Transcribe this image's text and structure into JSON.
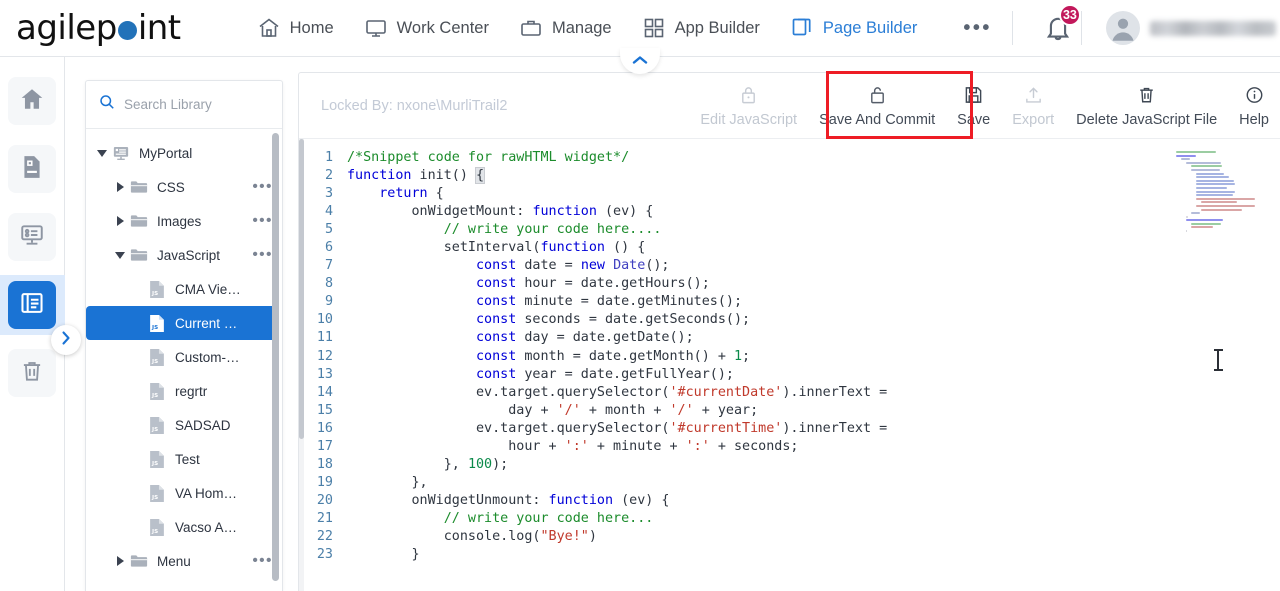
{
  "brand": {
    "name_part1": "agilep",
    "name_part2": "int"
  },
  "topnav": {
    "items": [
      {
        "label": "Home",
        "icon": "home-icon",
        "active": false
      },
      {
        "label": "Work Center",
        "icon": "monitor-icon",
        "active": false
      },
      {
        "label": "Manage",
        "icon": "briefcase-icon",
        "active": false
      },
      {
        "label": "App Builder",
        "icon": "grid-icon",
        "active": false
      },
      {
        "label": "Page Builder",
        "icon": "pages-icon",
        "active": true
      }
    ],
    "more_label": "•••",
    "notification_count": "33",
    "username": "",
    "collapse_label": "collapse-navigation"
  },
  "rail": {
    "items": [
      {
        "name": "home",
        "icon": "home-icon",
        "active": false
      },
      {
        "name": "pages",
        "icon": "page-icon",
        "active": false
      },
      {
        "name": "forms",
        "icon": "form-layout-icon",
        "active": false
      },
      {
        "name": "library",
        "icon": "library-icon",
        "active": true
      },
      {
        "name": "recycle-bin",
        "icon": "trash-icon",
        "active": false
      }
    ],
    "expand_label": "expand-rail"
  },
  "library": {
    "search_placeholder": "Search Library",
    "search_value": "",
    "tree": [
      {
        "label": "MyPortal",
        "icon": "portal-icon",
        "indent": 0,
        "toggle": "down",
        "dots": false,
        "selected": false
      },
      {
        "label": "CSS",
        "icon": "folder-icon",
        "indent": 1,
        "toggle": "right",
        "dots": true,
        "selected": false
      },
      {
        "label": "Images",
        "icon": "folder-icon",
        "indent": 1,
        "toggle": "right",
        "dots": true,
        "selected": false
      },
      {
        "label": "JavaScript",
        "icon": "folder-icon",
        "indent": 1,
        "toggle": "down",
        "dots": true,
        "selected": false
      },
      {
        "label": "CMA Vie…",
        "icon": "js-file-icon",
        "indent": 2,
        "toggle": "none",
        "dots": false,
        "selected": false
      },
      {
        "label": "Current …",
        "icon": "js-file-icon",
        "indent": 2,
        "toggle": "none",
        "dots": false,
        "selected": true
      },
      {
        "label": "Custom-…",
        "icon": "js-file-icon",
        "indent": 2,
        "toggle": "none",
        "dots": false,
        "selected": false
      },
      {
        "label": "regrtr",
        "icon": "js-file-icon",
        "indent": 2,
        "toggle": "none",
        "dots": false,
        "selected": false
      },
      {
        "label": "SADSAD",
        "icon": "js-file-icon",
        "indent": 2,
        "toggle": "none",
        "dots": false,
        "selected": false
      },
      {
        "label": "Test",
        "icon": "js-file-icon",
        "indent": 2,
        "toggle": "none",
        "dots": false,
        "selected": false
      },
      {
        "label": "VA Hom…",
        "icon": "js-file-icon",
        "indent": 2,
        "toggle": "none",
        "dots": false,
        "selected": false
      },
      {
        "label": "Vacso A…",
        "icon": "js-file-icon",
        "indent": 2,
        "toggle": "none",
        "dots": false,
        "selected": false
      },
      {
        "label": "Menu",
        "icon": "folder-icon",
        "indent": 1,
        "toggle": "right",
        "dots": true,
        "selected": false
      }
    ]
  },
  "editor": {
    "locked_by": "Locked By: nxone\\MurliTrail2",
    "toolbar": [
      {
        "label": "Edit JavaScript",
        "icon": "lock-closed-icon",
        "disabled": true,
        "highlighted": false
      },
      {
        "label": "Save And Commit",
        "icon": "lock-open-icon",
        "disabled": false,
        "highlighted": true
      },
      {
        "label": "Save",
        "icon": "floppy-icon",
        "disabled": false,
        "highlighted": false
      },
      {
        "label": "Export",
        "icon": "upload-icon",
        "disabled": true,
        "highlighted": false
      },
      {
        "label": "Delete JavaScript File",
        "icon": "trash-icon",
        "disabled": false,
        "highlighted": false
      },
      {
        "label": "Help",
        "icon": "info-icon",
        "disabled": false,
        "highlighted": false
      }
    ],
    "highlight_color": "#ee1c25",
    "lines": [
      {
        "n": "1",
        "code": "/*Snippet code for rawHTML widget*/"
      },
      {
        "n": "2",
        "code": "function init() {"
      },
      {
        "n": "3",
        "code": "    return {"
      },
      {
        "n": "4",
        "code": "        onWidgetMount: function (ev) {"
      },
      {
        "n": "5",
        "code": "            // write your code here...."
      },
      {
        "n": "6",
        "code": "            setInterval(function () {"
      },
      {
        "n": "7",
        "code": "                const date = new Date();"
      },
      {
        "n": "8",
        "code": "                const hour = date.getHours();"
      },
      {
        "n": "9",
        "code": "                const minute = date.getMinutes();"
      },
      {
        "n": "10",
        "code": "                const seconds = date.getSeconds();"
      },
      {
        "n": "11",
        "code": "                const day = date.getDate();"
      },
      {
        "n": "12",
        "code": "                const month = date.getMonth() + 1;"
      },
      {
        "n": "13",
        "code": "                const year = date.getFullYear();"
      },
      {
        "n": "14",
        "code": "                ev.target.querySelector('#currentDate').innerText ="
      },
      {
        "n": "15",
        "code": "                    day + '/' + month + '/' + year;"
      },
      {
        "n": "16",
        "code": "                ev.target.querySelector('#currentTime').innerText ="
      },
      {
        "n": "17",
        "code": "                    hour + ':' + minute + ':' + seconds;"
      },
      {
        "n": "18",
        "code": "            }, 100);"
      },
      {
        "n": "19",
        "code": "        },"
      },
      {
        "n": "20",
        "code": "        onWidgetUnmount: function (ev) {"
      },
      {
        "n": "21",
        "code": "            // write your code here..."
      },
      {
        "n": "22",
        "code": "            console.log(\"Bye!\")"
      },
      {
        "n": "23",
        "code": "        }"
      }
    ]
  }
}
